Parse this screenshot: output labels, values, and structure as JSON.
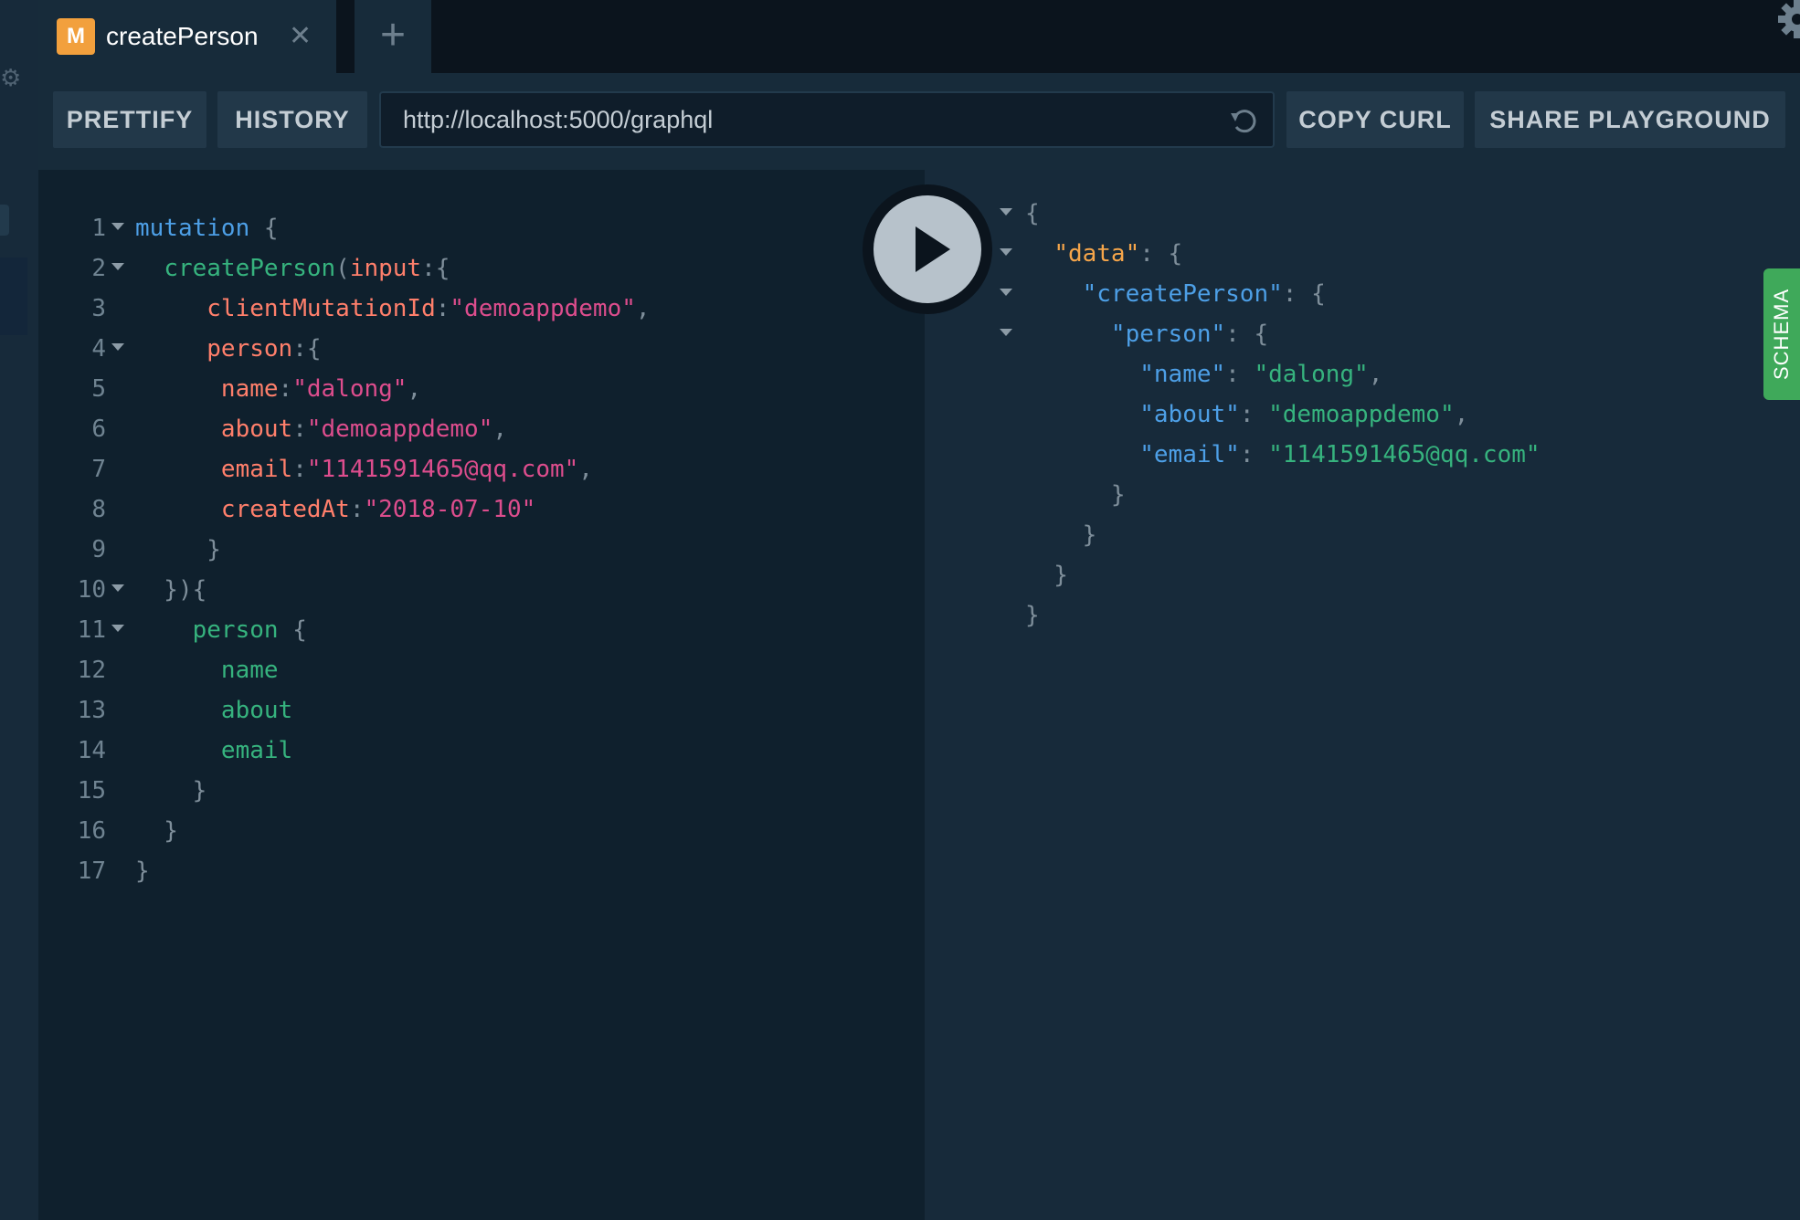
{
  "tab": {
    "badge": "M",
    "title": "createPerson",
    "close": "✕"
  },
  "new_tab": "+",
  "toolbar": {
    "prettify": "PRETTIFY",
    "history": "HISTORY",
    "url": "http://localhost:5000/graphql",
    "copy_curl": "COPY CURL",
    "share": "SHARE PLAYGROUND"
  },
  "schema_tab": "SCHEMA",
  "editor": {
    "lines": [
      {
        "n": "1",
        "fold": true,
        "tokens": [
          {
            "t": "kw",
            "v": "mutation"
          },
          {
            "t": "punc",
            "v": " {"
          }
        ]
      },
      {
        "n": "2",
        "fold": true,
        "tokens": [
          {
            "t": "punc",
            "v": "  "
          },
          {
            "t": "fn",
            "v": "createPerson"
          },
          {
            "t": "punc",
            "v": "("
          },
          {
            "t": "prop",
            "v": "input"
          },
          {
            "t": "punc",
            "v": ":{"
          }
        ]
      },
      {
        "n": "3",
        "fold": false,
        "tokens": [
          {
            "t": "punc",
            "v": "     "
          },
          {
            "t": "prop",
            "v": "clientMutationId"
          },
          {
            "t": "punc",
            "v": ":"
          },
          {
            "t": "str",
            "v": "\"demoappdemo\""
          },
          {
            "t": "punc",
            "v": ","
          }
        ]
      },
      {
        "n": "4",
        "fold": true,
        "tokens": [
          {
            "t": "punc",
            "v": "     "
          },
          {
            "t": "prop",
            "v": "person"
          },
          {
            "t": "punc",
            "v": ":{"
          }
        ]
      },
      {
        "n": "5",
        "fold": false,
        "tokens": [
          {
            "t": "punc",
            "v": "      "
          },
          {
            "t": "prop",
            "v": "name"
          },
          {
            "t": "punc",
            "v": ":"
          },
          {
            "t": "str",
            "v": "\"dalong\""
          },
          {
            "t": "punc",
            "v": ","
          }
        ]
      },
      {
        "n": "6",
        "fold": false,
        "tokens": [
          {
            "t": "punc",
            "v": "      "
          },
          {
            "t": "prop",
            "v": "about"
          },
          {
            "t": "punc",
            "v": ":"
          },
          {
            "t": "str",
            "v": "\"demoappdemo\""
          },
          {
            "t": "punc",
            "v": ","
          }
        ]
      },
      {
        "n": "7",
        "fold": false,
        "tokens": [
          {
            "t": "punc",
            "v": "      "
          },
          {
            "t": "prop",
            "v": "email"
          },
          {
            "t": "punc",
            "v": ":"
          },
          {
            "t": "str",
            "v": "\"1141591465@qq.com\""
          },
          {
            "t": "punc",
            "v": ","
          }
        ]
      },
      {
        "n": "8",
        "fold": false,
        "tokens": [
          {
            "t": "punc",
            "v": "      "
          },
          {
            "t": "prop",
            "v": "createdAt"
          },
          {
            "t": "punc",
            "v": ":"
          },
          {
            "t": "str",
            "v": "\"2018-07-10\""
          }
        ]
      },
      {
        "n": "9",
        "fold": false,
        "tokens": [
          {
            "t": "punc",
            "v": "     }"
          }
        ]
      },
      {
        "n": "10",
        "fold": true,
        "tokens": [
          {
            "t": "punc",
            "v": "  }){"
          }
        ]
      },
      {
        "n": "11",
        "fold": true,
        "tokens": [
          {
            "t": "punc",
            "v": "    "
          },
          {
            "t": "field",
            "v": "person"
          },
          {
            "t": "punc",
            "v": " {"
          }
        ]
      },
      {
        "n": "12",
        "fold": false,
        "tokens": [
          {
            "t": "punc",
            "v": "      "
          },
          {
            "t": "field",
            "v": "name"
          }
        ]
      },
      {
        "n": "13",
        "fold": false,
        "tokens": [
          {
            "t": "punc",
            "v": "      "
          },
          {
            "t": "field",
            "v": "about"
          }
        ]
      },
      {
        "n": "14",
        "fold": false,
        "tokens": [
          {
            "t": "punc",
            "v": "      "
          },
          {
            "t": "field",
            "v": "email"
          }
        ]
      },
      {
        "n": "15",
        "fold": false,
        "tokens": [
          {
            "t": "punc",
            "v": "    }"
          }
        ]
      },
      {
        "n": "16",
        "fold": false,
        "tokens": [
          {
            "t": "punc",
            "v": "  }"
          }
        ]
      },
      {
        "n": "17",
        "fold": false,
        "tokens": [
          {
            "t": "punc",
            "v": "}"
          }
        ]
      }
    ]
  },
  "result": {
    "lines": [
      {
        "fold": true,
        "tokens": [
          {
            "t": "punc",
            "v": "{"
          }
        ]
      },
      {
        "fold": true,
        "tokens": [
          {
            "t": "punc",
            "v": "  "
          },
          {
            "t": "data",
            "v": "\"data\""
          },
          {
            "t": "punc",
            "v": ": {"
          }
        ]
      },
      {
        "fold": true,
        "tokens": [
          {
            "t": "punc",
            "v": "    "
          },
          {
            "t": "key",
            "v": "\"createPerson\""
          },
          {
            "t": "punc",
            "v": ": {"
          }
        ]
      },
      {
        "fold": true,
        "tokens": [
          {
            "t": "punc",
            "v": "      "
          },
          {
            "t": "key",
            "v": "\"person\""
          },
          {
            "t": "punc",
            "v": ": {"
          }
        ]
      },
      {
        "fold": false,
        "tokens": [
          {
            "t": "punc",
            "v": "        "
          },
          {
            "t": "key",
            "v": "\"name\""
          },
          {
            "t": "punc",
            "v": ": "
          },
          {
            "t": "str",
            "v": "\"dalong\""
          },
          {
            "t": "punc",
            "v": ","
          }
        ]
      },
      {
        "fold": false,
        "tokens": [
          {
            "t": "punc",
            "v": "        "
          },
          {
            "t": "key",
            "v": "\"about\""
          },
          {
            "t": "punc",
            "v": ": "
          },
          {
            "t": "str",
            "v": "\"demoappdemo\""
          },
          {
            "t": "punc",
            "v": ","
          }
        ]
      },
      {
        "fold": false,
        "tokens": [
          {
            "t": "punc",
            "v": "        "
          },
          {
            "t": "key",
            "v": "\"email\""
          },
          {
            "t": "punc",
            "v": ": "
          },
          {
            "t": "str",
            "v": "\"1141591465@qq.com\""
          }
        ]
      },
      {
        "fold": false,
        "tokens": [
          {
            "t": "punc",
            "v": "      }"
          }
        ]
      },
      {
        "fold": false,
        "tokens": [
          {
            "t": "punc",
            "v": "    }"
          }
        ]
      },
      {
        "fold": false,
        "tokens": [
          {
            "t": "punc",
            "v": "  }"
          }
        ]
      },
      {
        "fold": false,
        "tokens": [
          {
            "t": "punc",
            "v": "}"
          }
        ]
      }
    ]
  },
  "colors": {
    "badge": "#f2a03d",
    "keyword": "#4d9fe6",
    "string": "#dd4d8d",
    "property": "#ff7f6b",
    "field": "#36b37e",
    "schema": "#3fa95a"
  }
}
